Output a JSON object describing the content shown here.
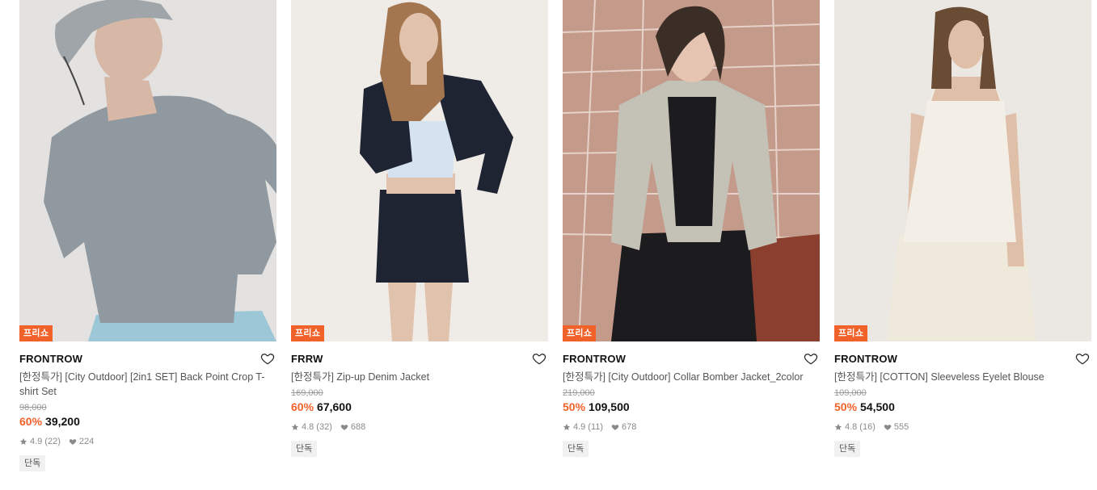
{
  "products": [
    {
      "badge": "프리쇼",
      "brand": "FRONTROW",
      "title": "[한정특가] [City Outdoor] [2in1 SET] Back Point Crop T-shirt Set",
      "original_price": "98,000",
      "discount": "60%",
      "sale_price": "39,200",
      "rating": "4.9",
      "reviews": "(22)",
      "likes": "224",
      "tag": "단독",
      "colors": {
        "bg": "#e9e7e5",
        "garment": "#8f999f",
        "accent": "#9bc7d6",
        "skin": "#d7b8a6",
        "hair": "#6b5a4b"
      }
    },
    {
      "badge": "프리쇼",
      "brand": "FRRW",
      "title": "[한정특가] Zip-up Denim Jacket",
      "original_price": "169,000",
      "discount": "60%",
      "sale_price": "67,600",
      "rating": "4.8",
      "reviews": "(32)",
      "likes": "688",
      "tag": "단독",
      "colors": {
        "bg": "#efebe7",
        "garment": "#1f2433",
        "accent": "#d5e3f0",
        "skin": "#e1c2ad",
        "hair": "#a37650"
      }
    },
    {
      "badge": "프리쇼",
      "brand": "FRONTROW",
      "title": "[한정특가] [City Outdoor] Collar Bomber Jacket_2color",
      "original_price": "219,000",
      "discount": "50%",
      "sale_price": "109,500",
      "rating": "4.9",
      "reviews": "(11)",
      "likes": "678",
      "tag": "단독",
      "colors": {
        "bg": "#c49a8a",
        "garment": "#c4c2b7",
        "accent": "#1c1c1e",
        "skin": "#e5c5b2",
        "hair": "#3b2e26"
      }
    },
    {
      "badge": "프리쇼",
      "brand": "FRONTROW",
      "title": "[한정특가] [COTTON] Sleeveless Eyelet Blouse",
      "original_price": "109,000",
      "discount": "50%",
      "sale_price": "54,500",
      "rating": "4.8",
      "reviews": "(16)",
      "likes": "555",
      "tag": "단독",
      "colors": {
        "bg": "#ebe7e3",
        "garment": "#f3efe6",
        "accent": "#efe9dc",
        "skin": "#dfbfa8",
        "hair": "#6a4b34"
      }
    }
  ]
}
